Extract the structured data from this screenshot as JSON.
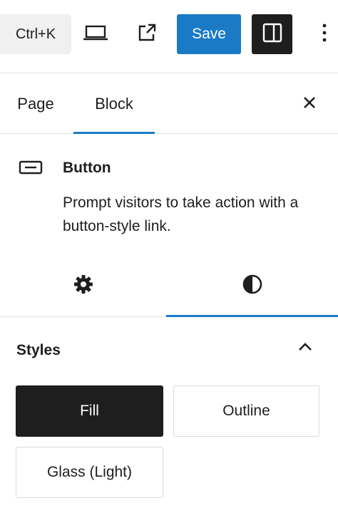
{
  "topbar": {
    "shortcut_label": "Ctrl+K",
    "preview_icon": "laptop-icon",
    "view_icon": "external-link-icon",
    "save_label": "Save",
    "sidebar_icon": "sidebar-toggle-icon",
    "options_icon": "more-vertical-icon"
  },
  "tabs": {
    "page_label": "Page",
    "block_label": "Block",
    "active": "Block",
    "close_icon": "close-icon"
  },
  "block": {
    "icon": "button-block-icon",
    "title": "Button",
    "description": "Prompt visitors to take action with a button-style link."
  },
  "inspector_tabs": {
    "settings_icon": "gear-icon",
    "styles_icon": "contrast-icon",
    "active": "styles"
  },
  "styles": {
    "title": "Styles",
    "options": [
      "Fill",
      "Outline",
      "Glass (Light)"
    ],
    "selected": "Fill"
  },
  "colors": {
    "accent": "#1a7ac6",
    "dark": "#1e1e1e",
    "border": "#e0e0e0"
  }
}
